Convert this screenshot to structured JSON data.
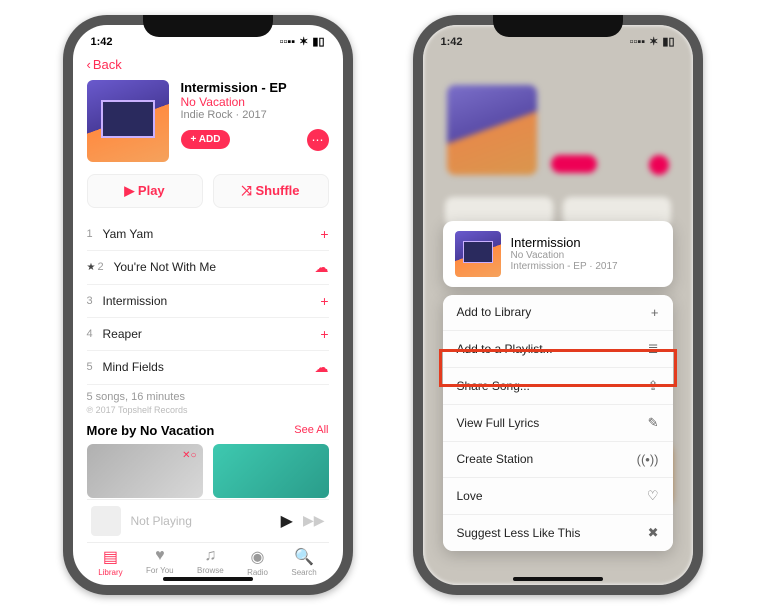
{
  "status": {
    "time": "1:42",
    "signal": "▪▪▪",
    "wifi": "⌵",
    "battery": "▮▮"
  },
  "nav": {
    "back": "Back"
  },
  "album": {
    "title": "Intermission - EP",
    "artist": "No Vacation",
    "meta": "Indie Rock · 2017",
    "add_label": "+ ADD"
  },
  "buttons": {
    "play": "▶  Play",
    "shuffle": "⤨  Shuffle"
  },
  "tracks": [
    {
      "n": "1",
      "name": "Yam Yam",
      "icon": "+"
    },
    {
      "n": "2",
      "name": "You're Not With Me",
      "icon": "☁",
      "starred": true
    },
    {
      "n": "3",
      "name": "Intermission",
      "icon": "+"
    },
    {
      "n": "4",
      "name": "Reaper",
      "icon": "+"
    },
    {
      "n": "5",
      "name": "Mind Fields",
      "icon": "☁"
    }
  ],
  "summary": {
    "line": "5 songs, 16 minutes",
    "copyright": "℗ 2017 Topshelf Records"
  },
  "more": {
    "header": "More by No Vacation",
    "see_all": "See All"
  },
  "now_playing": {
    "text": "Not Playing"
  },
  "tabs": {
    "library": "Library",
    "for_you": "For You",
    "browse": "Browse",
    "radio": "Radio",
    "search": "Search"
  },
  "sheet": {
    "title": "Intermission",
    "artist": "No Vacation",
    "meta": "Intermission - EP · 2017",
    "items": {
      "add_library": "Add to Library",
      "add_playlist": "Add to a Playlist...",
      "share": "Share Song...",
      "lyrics": "View Full Lyrics",
      "station": "Create Station",
      "love": "Love",
      "less": "Suggest Less Like This"
    },
    "icons": {
      "add_library": "+",
      "add_playlist": "≣",
      "share": "⇪",
      "lyrics": "✎",
      "station": "((•))",
      "love": "♡",
      "less": "✖"
    }
  }
}
